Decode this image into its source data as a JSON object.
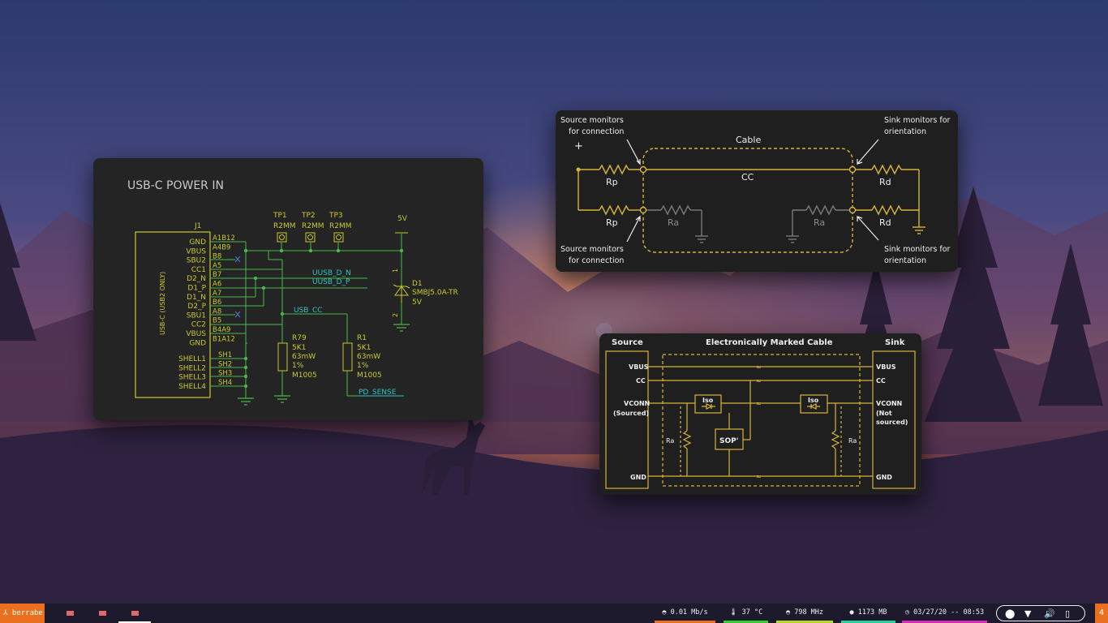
{
  "desktop": {
    "wallpaper": "mountain-sunset-deer-wallpaper"
  },
  "windows": {
    "schematic": {
      "title": "USB-C POWER IN",
      "connector_ref": "J1",
      "connector_side_label": "USB-C (USB2 ONLY)",
      "pins": [
        "GND",
        "VBUS",
        "SBU2",
        "CC1",
        "D2_N",
        "D1_P",
        "D1_N",
        "D2_P",
        "SBU1",
        "CC2",
        "VBUS",
        "GND"
      ],
      "pin_numbers": [
        "A1B12",
        "A4B9",
        "B8",
        "A5",
        "B7",
        "A6",
        "A7",
        "B6",
        "A8",
        "B5",
        "B4A9",
        "B1A12"
      ],
      "shells": [
        "SHELL1",
        "SHELL2",
        "SHELL3",
        "SHELL4"
      ],
      "shell_numbers": [
        "SH1",
        "SH2",
        "SH3",
        "SH4"
      ],
      "test_points": [
        {
          "ref": "TP1",
          "value": "R2MM"
        },
        {
          "ref": "TP2",
          "value": "R2MM"
        },
        {
          "ref": "TP3",
          "value": "R2MM"
        }
      ],
      "rail_5v": "5V",
      "nets": {
        "dn": "UUSB_D_N",
        "dp": "UUSB_D_P",
        "cc": "USB_CC",
        "pd": "PD_SENSE"
      },
      "diode": {
        "ref": "D1",
        "part": "SMBJ5.0A-TR",
        "value": "5V",
        "pin1": "1",
        "pin2": "2"
      },
      "r79": {
        "ref": "R79",
        "value": "5K1",
        "power": "63mW",
        "tol": "1%",
        "pkg": "M1005"
      },
      "r1": {
        "ref": "R1",
        "value": "5K1",
        "power": "63mW",
        "tol": "1%",
        "pkg": "M1005"
      }
    },
    "cc_diagram": {
      "plus": "+",
      "cable": "Cable",
      "cc": "CC",
      "rp_top": "Rp",
      "rp_bottom": "Rp",
      "rd_top": "Rd",
      "rd_bottom": "Rd",
      "ra_left": "Ra",
      "ra_right": "Ra",
      "source_top": [
        "Source monitors",
        "for connection"
      ],
      "source_bottom": [
        "Source monitors",
        "for connection"
      ],
      "sink_top": [
        "Sink monitors for",
        "orientation"
      ],
      "sink_bottom": [
        "Sink monitors for",
        "orientation"
      ]
    },
    "emarker_diagram": {
      "source": "Source",
      "title": "Electronically Marked Cable",
      "sink": "Sink",
      "left_labels": {
        "vbus": "VBUS",
        "cc": "CC",
        "vconn": "VCONN",
        "vconn_sub": "(Sourced)",
        "gnd": "GND"
      },
      "right_labels": {
        "vbus": "VBUS",
        "cc": "CC",
        "vconn": "VCONN",
        "vconn_sub1": "(Not",
        "vconn_sub2": "sourced)",
        "gnd": "GND"
      },
      "iso_left": "Iso",
      "iso_right": "Iso",
      "sop": "SOP'",
      "ra_left": "Ra",
      "ra_right": "Ra"
    }
  },
  "taskbar": {
    "launcher": "⅄ berrabe",
    "apps": [
      "app-1",
      "app-2",
      "app-3"
    ],
    "stats": [
      {
        "text": "◓ 0.01 Mb/s",
        "color": "#e8701f"
      },
      {
        "text": "🌡 37 °C",
        "color": "#33cc33"
      },
      {
        "text": "◓ 798 MHz",
        "color": "#b8d82a"
      },
      {
        "text": "● 1173 MB",
        "color": "#2ed09a"
      },
      {
        "text": "◷ 03/27/20 -- 08:53",
        "color": "#d42ab8"
      }
    ],
    "workspace": "4"
  }
}
